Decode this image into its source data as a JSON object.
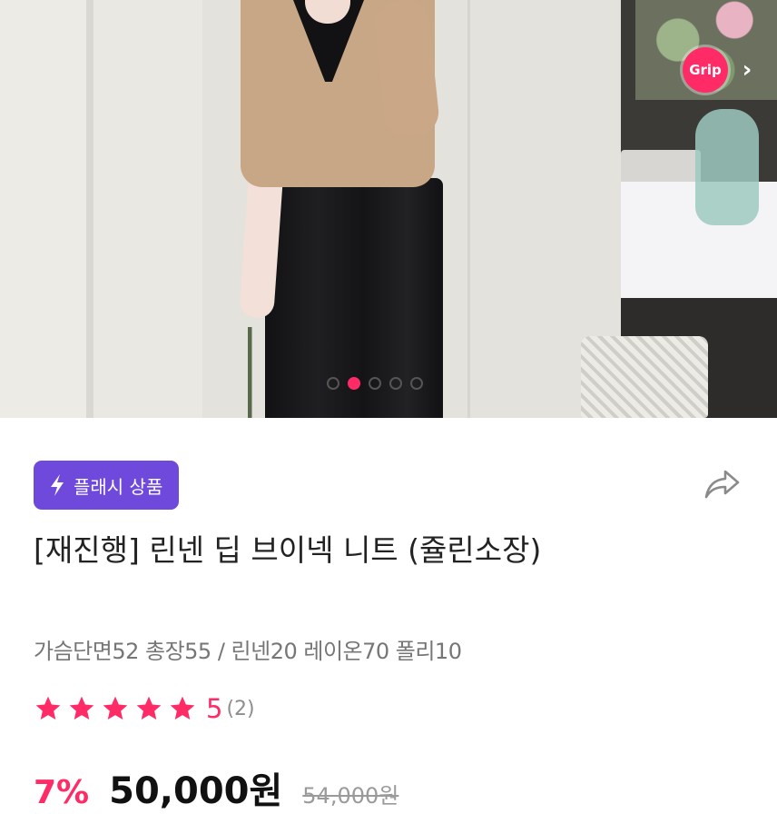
{
  "carousel": {
    "total_slides": 5,
    "active_index": 1,
    "grip_label": "Grip",
    "grip_chevron": "›"
  },
  "badge": {
    "label": "플래시 상품",
    "icon": "lightning-bolt-icon",
    "color": "#6e49dc"
  },
  "share_icon": "share-arrow-icon",
  "product": {
    "title": "[재진행] 린넨 딥 브이넥 니트 (쥴린소장)",
    "spec": "가슴단면52 총장55 / 린넨20 레이온70 폴리10"
  },
  "rating": {
    "stars": 5,
    "value": "5",
    "count": "(2)",
    "color": "#ff2b66"
  },
  "price": {
    "discount": "7%",
    "current": "50,000원",
    "original": "54,000원"
  }
}
